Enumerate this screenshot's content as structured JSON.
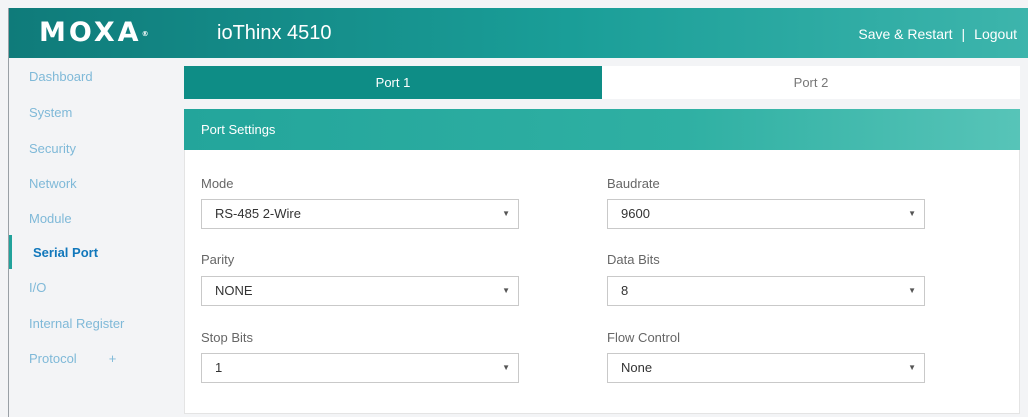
{
  "header": {
    "logo_text": "MOXA",
    "logo_mark": "®",
    "product": "ioThinx 4510",
    "save_restart": "Save & Restart",
    "separator": "|",
    "logout": "Logout"
  },
  "sidebar": {
    "items": [
      {
        "label": "Dashboard"
      },
      {
        "label": "System"
      },
      {
        "label": "Security"
      },
      {
        "label": "Network"
      },
      {
        "label": "Module"
      },
      {
        "label": "Serial Port"
      },
      {
        "label": "I/O"
      },
      {
        "label": "Internal Register"
      },
      {
        "label": "Protocol",
        "expand": "+"
      }
    ],
    "active": "Serial Port"
  },
  "tabs": [
    {
      "label": "Port 1",
      "active": true
    },
    {
      "label": "Port 2",
      "active": false
    }
  ],
  "panel": {
    "title": "Port Settings",
    "fields": {
      "mode": {
        "label": "Mode",
        "value": "RS-485 2-Wire"
      },
      "baudrate": {
        "label": "Baudrate",
        "value": "9600"
      },
      "parity": {
        "label": "Parity",
        "value": "NONE"
      },
      "data_bits": {
        "label": "Data Bits",
        "value": "8"
      },
      "stop_bits": {
        "label": "Stop Bits",
        "value": "1"
      },
      "flow_control": {
        "label": "Flow Control",
        "value": "None"
      }
    },
    "caret_glyph": "▼"
  },
  "colors": {
    "header_start": "#0f7b7a",
    "accent": "#21a29b",
    "sidebar_text": "#7fb9d8",
    "active_text": "#1177bb"
  }
}
